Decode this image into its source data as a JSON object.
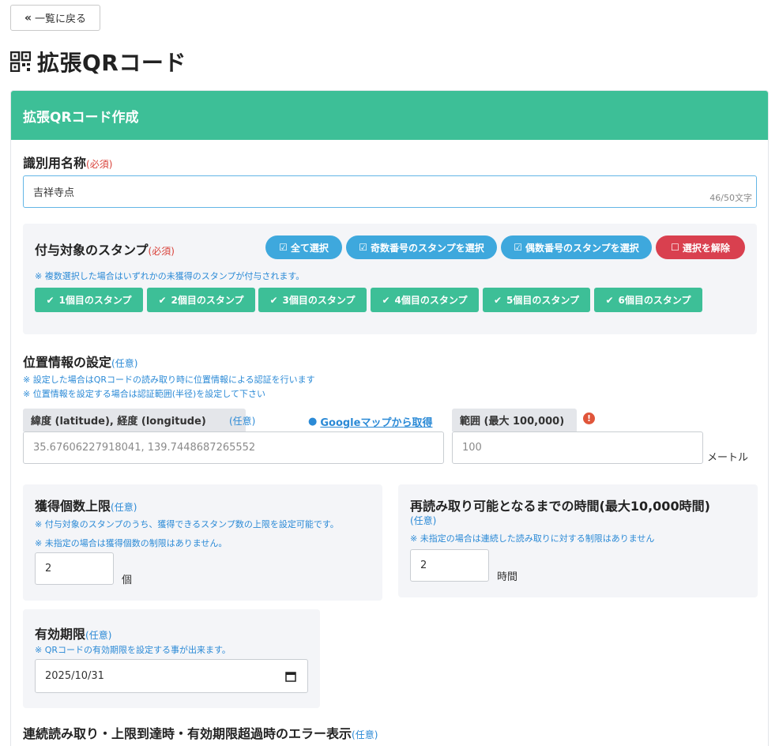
{
  "back_button": {
    "icon": "double-chevron-left-icon",
    "label": "一覧に戻る"
  },
  "page": {
    "icon": "qr-code-icon",
    "title": "拡張QRコード"
  },
  "card": {
    "header": "拡張QRコード作成"
  },
  "identifier": {
    "label": "識別用名称",
    "required": "(必須)",
    "value": "吉祥寺点",
    "counter": "46/50文字"
  },
  "stamps": {
    "label": "付与対象のスタンプ",
    "required": "(必須)",
    "buttons": {
      "select_all": "全て選択",
      "select_odd": "奇数番号のスタンプを選択",
      "select_even": "偶数番号のスタンプを選択",
      "deselect": "選択を解除"
    },
    "note": "※ 複数選択した場合はいずれかの未獲得のスタンプが付与されます。",
    "items": [
      "1個目のスタンプ",
      "2個目のスタンプ",
      "3個目のスタンプ",
      "4個目のスタンプ",
      "5個目のスタンプ",
      "6個目のスタンプ"
    ]
  },
  "location": {
    "label": "位置情報の設定",
    "optional": "(任意)",
    "note1": "※ 設定した場合はQRコードの読み取り時に位置情報による認証を行います",
    "note2": "※ 位置情報を設定する場合は認証範囲(半径)を設定して下さい",
    "latlng_label": "緯度 (latitude), 経度 (longitude)",
    "latlng_optional": "(任意)",
    "google_link": "Googleマップから取得",
    "latlng_placeholder": "35.67606227918041, 139.7448687265552",
    "range_label": "範囲 (最大 100,000)",
    "range_placeholder": "100",
    "range_unit": "メートル"
  },
  "limit": {
    "label": "獲得個数上限",
    "optional": "(任意)",
    "note1": "※ 付与対象のスタンプのうち、獲得できるスタンプ数の上限を設定可能です。",
    "note2": "※ 未指定の場合は獲得個数の制限はありません。",
    "value": "2",
    "unit": "個"
  },
  "reread": {
    "label": "再読み取り可能となるまでの時間(最大10,000時間)",
    "optional": "(任意)",
    "note": "※ 未指定の場合は連続した読み取りに対する制限はありません",
    "value": "2",
    "unit": "時間"
  },
  "expiry": {
    "label": "有効期限",
    "optional": "(任意)",
    "note": "※ QRコードの有効期限を設定する事が出来ます。",
    "value": "2025/10/31"
  },
  "error_display": {
    "label": "連続読み取り・上限到達時・有効期限超過時のエラー表示",
    "optional": "(任意)"
  },
  "colors": {
    "primary": "#3dbf97",
    "info": "#3ea8dd",
    "danger": "#d9404f",
    "note": "#2b8ad6"
  }
}
